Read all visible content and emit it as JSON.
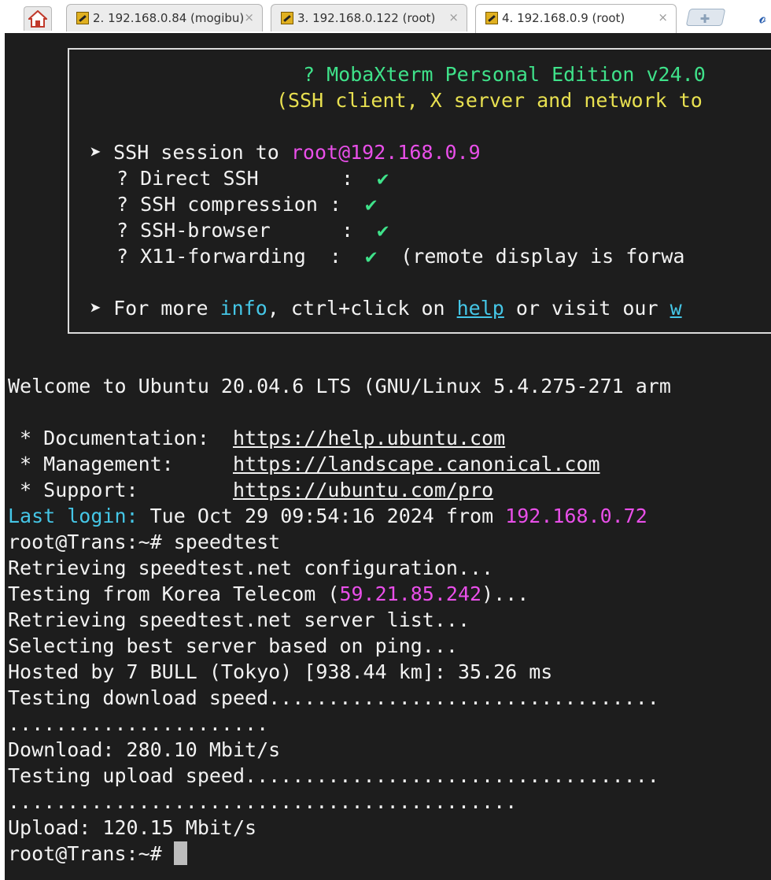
{
  "tabs": [
    {
      "label": "2. 192.168.0.84 (mogibu)",
      "close": "×"
    },
    {
      "label": "3. 192.168.0.122 (root)",
      "close": "×"
    },
    {
      "label": "4. 192.168.0.9 (root)",
      "close": "×"
    }
  ],
  "colors": {
    "terminal_bg": "#1d1d1d",
    "green": "#3fe28a",
    "yellow": "#e8e050",
    "magenta": "#e94fe9",
    "cyan": "#45c6e6"
  },
  "banner": {
    "title": "? MobaXterm Personal Edition v24.0",
    "subtitle": "(SSH client, X server and network to",
    "session_prefix": "➤ SSH session to ",
    "session_host": "root@192.168.0.9",
    "rows": [
      {
        "text": "? Direct SSH       :  ",
        "check": "✔",
        "extra": ""
      },
      {
        "text": "? SSH compression :  ",
        "check": "✔",
        "extra": ""
      },
      {
        "text": "? SSH-browser      :  ",
        "check": "✔",
        "extra": ""
      },
      {
        "text": "? X11-forwarding  :  ",
        "check": "✔",
        "extra": "  (remote display is forwa"
      }
    ],
    "more_prefix": "➤ For more ",
    "more_info": "info",
    "more_mid": ", ctrl+click on ",
    "more_help": "help",
    "more_tail": " or visit our ",
    "more_w": "w"
  },
  "welcome": "Welcome to Ubuntu 20.04.6 LTS (GNU/Linux 5.4.275-271 arm",
  "docs": [
    {
      "label": " * Documentation:  ",
      "url": "https://help.ubuntu.com"
    },
    {
      "label": " * Management:     ",
      "url": "https://landscape.canonical.com"
    },
    {
      "label": " * Support:        ",
      "url": "https://ubuntu.com/pro"
    }
  ],
  "last_login": {
    "label": "Last login:",
    "text": " Tue Oct 29 09:54:16 2024 from ",
    "ip": "192.168.0.72"
  },
  "prompt": "root@Trans:~# ",
  "command": "speedtest",
  "output": {
    "retrieving_config": "Retrieving speedtest.net configuration...",
    "testing_from_prefix": "Testing from Korea Telecom (",
    "testing_from_ip": "59.21.85.242",
    "testing_from_suffix": ")...",
    "retrieving_list": "Retrieving speedtest.net server list...",
    "selecting": "Selecting best server based on ping...",
    "hosted": "Hosted by 7 BULL (Tokyo) [938.44 km]: 35.26 ms",
    "testing_download": "Testing download speed.................................",
    "download_dots": "......................",
    "download": "Download: 280.10 Mbit/s",
    "testing_upload": "Testing upload speed...................................",
    "upload_dots": "...........................................",
    "upload": "Upload: 120.15 Mbit/s"
  },
  "final_prompt": "root@Trans:~# "
}
